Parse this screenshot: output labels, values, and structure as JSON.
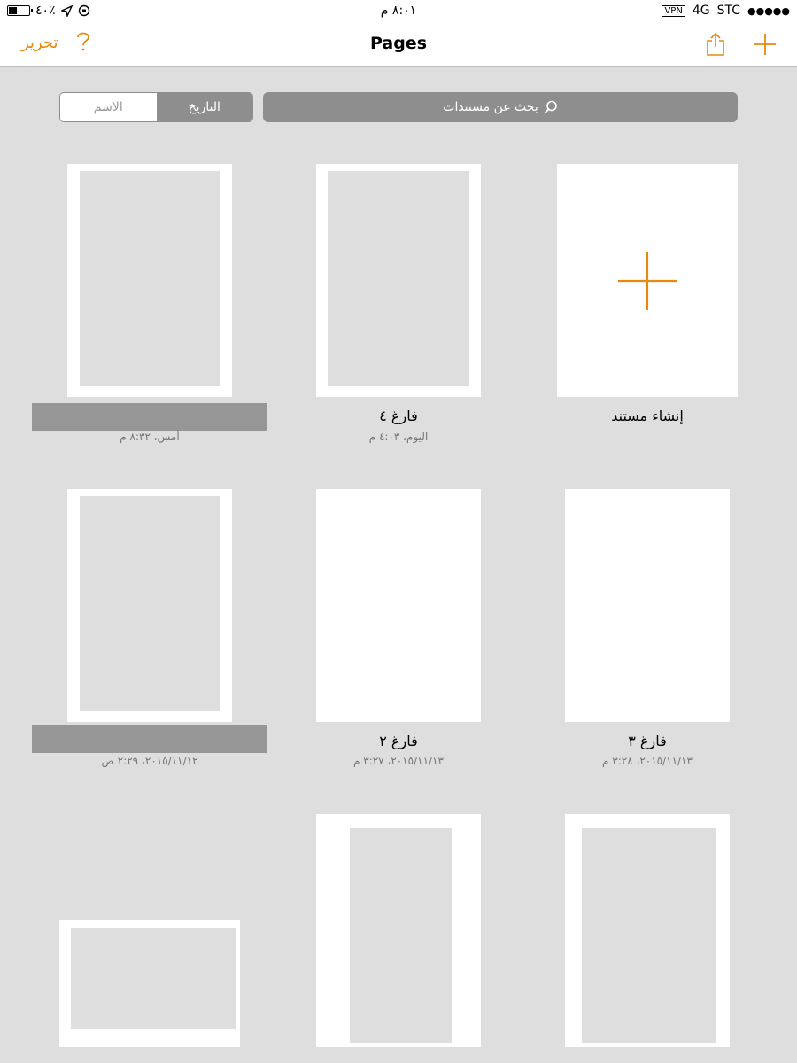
{
  "status_bar": {
    "battery_percent": "٤٠٪",
    "battery_level": 0.4,
    "time": "٨:٠١ م",
    "vpn": "VPN",
    "network": "4G",
    "carrier": "STC",
    "signal": "●●●●●"
  },
  "nav": {
    "title": "Pages",
    "edit_label": "تحرير",
    "help_icon": "question-mark-icon",
    "share_icon": "share-icon",
    "add_icon": "plus-icon"
  },
  "toolbar": {
    "sort_name": "الاسم",
    "sort_date": "التاريخ",
    "search_placeholder": "بحث عن مستندات"
  },
  "documents": [
    {
      "label": "إنشاء مستند"
    },
    {
      "label": "فارغ ٤",
      "date": "اليوم، ٤:٠٣ م"
    },
    {
      "label": "",
      "date": "أمس، ٨:٣٢ م"
    },
    {
      "label": "فارغ ٣",
      "date": "٢٠١٥/١١/١٣، ٣:٢٨ م"
    },
    {
      "label": "فارغ ٢",
      "date": "٢٠١٥/١١/١٣، ٣:٢٧ م"
    },
    {
      "label": "",
      "date": "٢٠١٥/١١/١٢، ٢:٢٩ ص"
    }
  ],
  "colors": {
    "accent": "#e8890c",
    "background": "#dedede",
    "control_gray": "#8e8e8e"
  }
}
